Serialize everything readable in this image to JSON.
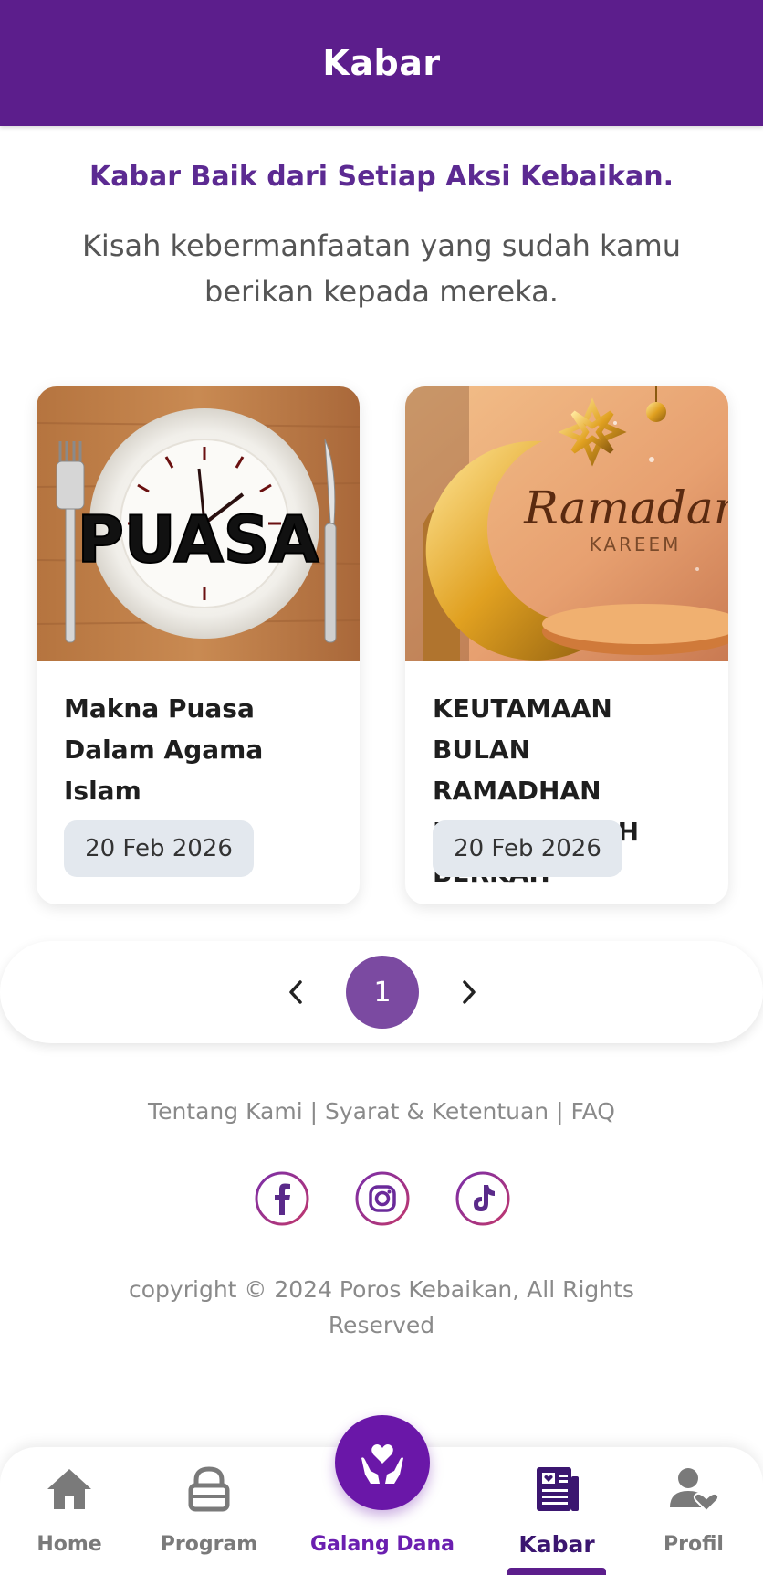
{
  "header": {
    "title": "Kabar"
  },
  "intro": {
    "headline": "Kabar Baik dari Setiap Aksi Kebaikan.",
    "subtitle": "Kisah kebermanfaatan yang sudah kamu berikan kepada mereka."
  },
  "articles": [
    {
      "title": "Makna Puasa Dalam Agama Islam",
      "date": "20 Feb 2026",
      "image_text": "PUASA"
    },
    {
      "title": "KEUTAMAAN BULAN RAMADHAN BULAN PENUH BERKAH",
      "date": "20 Feb 2026",
      "image_text": "Ramadan",
      "image_subtext": "KAREEM"
    }
  ],
  "pagination": {
    "current_page": "1"
  },
  "footer": {
    "link_about": "Tentang Kami",
    "separator": "|",
    "link_terms": "Syarat & Ketentuan",
    "link_faq": "FAQ",
    "copyright": "copyright © 2024 Poros Kebaikan, All Rights Reserved",
    "socials": [
      "facebook-icon",
      "instagram-icon",
      "tiktok-icon"
    ]
  },
  "bottom_nav": {
    "home": "Home",
    "program": "Program",
    "galang_dana": "Galang Dana",
    "kabar": "Kabar",
    "profil": "Profil",
    "active": "Kabar"
  },
  "colors": {
    "primary": "#5c1e8c",
    "accent": "#6a17a8",
    "page_active": "#7b4aa1",
    "date_bg": "#e3e8ee"
  }
}
